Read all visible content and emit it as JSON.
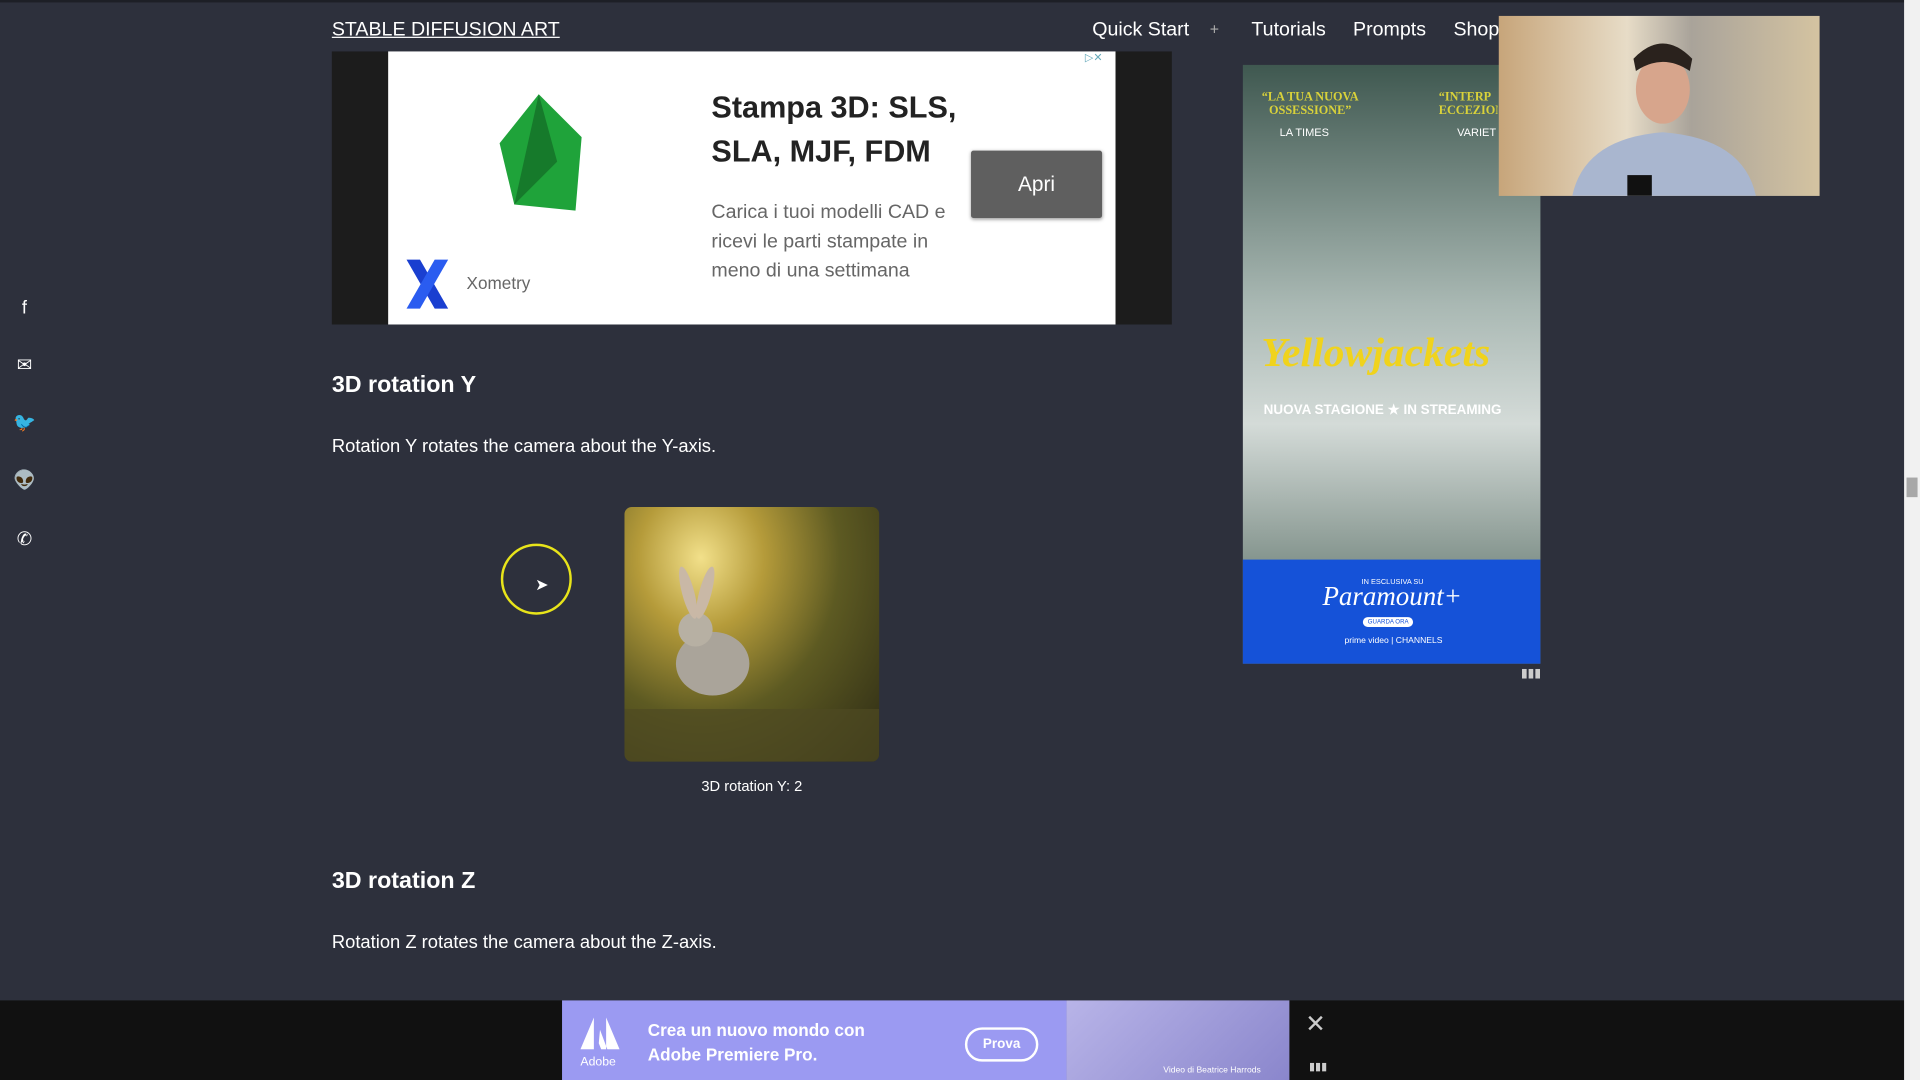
{
  "header": {
    "brand": "STABLE DIFFUSION ART",
    "nav": [
      "Quick Start",
      "+",
      "Tutorials",
      "Prompts",
      "Shop"
    ]
  },
  "share": [
    {
      "icon": "facebook-icon",
      "glyph": "f"
    },
    {
      "icon": "email-icon",
      "glyph": "✉"
    },
    {
      "icon": "twitter-icon",
      "glyph": "🐦"
    },
    {
      "icon": "reddit-icon",
      "glyph": "👽"
    },
    {
      "icon": "whatsapp-icon",
      "glyph": "✆"
    }
  ],
  "top_ad": {
    "title": "Stampa 3D: SLS, SLA, MJF, FDM",
    "description": "Carica i tuoi modelli CAD e ricevi le parti stampate in meno di una settimana",
    "advertiser": "Xometry",
    "button": "Apri"
  },
  "sections": [
    {
      "heading": "3D rotation Y",
      "text": "Rotation Y rotates the camera about the Y-axis.",
      "caption": "3D rotation Y: 2"
    },
    {
      "heading": "3D rotation Z",
      "text": "Rotation Z rotates the camera about the Z-axis."
    }
  ],
  "side_ad": {
    "quote1": "“LA TUA NUOVA OSSESSIONE”",
    "source1": "LA TIMES",
    "quote2": "“INTERP ECCEZION",
    "source2": "VARIET",
    "title": "Yellowjackets",
    "tagline": "NUOVA STAGIONE ★ IN STREAMING",
    "exclusive": "IN ESCLUSIVA SU",
    "brand": "Paramount+",
    "cta": "GUARDA ORA",
    "channels": "prime video | CHANNELS"
  },
  "bottom_ad": {
    "logo": "Adobe",
    "text_line1": "Crea un nuovo mondo con",
    "text_line2": "Adobe Premiere Pro.",
    "button": "Prova",
    "credit": "Video di Beatrice Harrods",
    "close": "✕"
  },
  "colors": {
    "background": "#2d303c",
    "adobe_ad": "#9b9af2",
    "paramount": "#1552d8",
    "xometry": "#1a3fd0"
  }
}
